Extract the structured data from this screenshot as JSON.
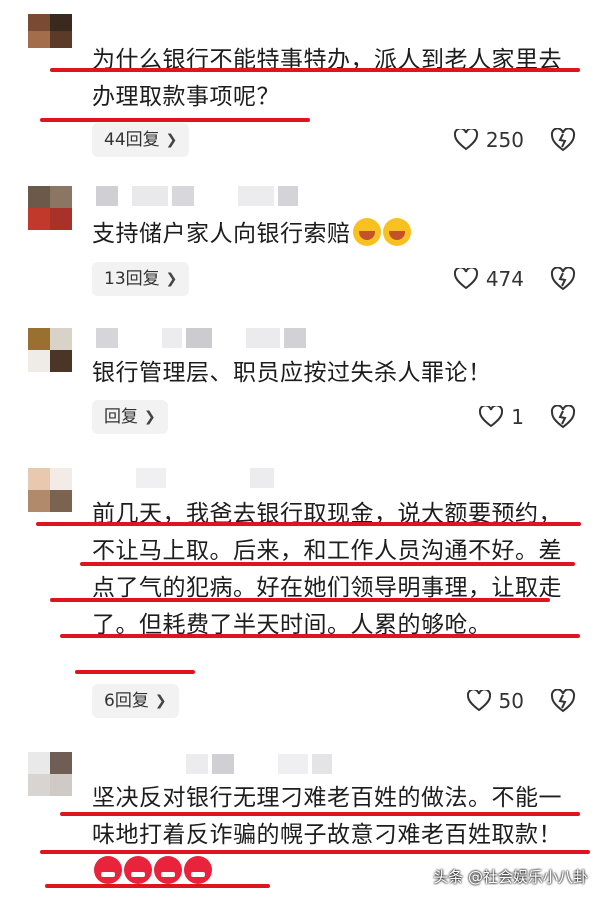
{
  "comments": [
    {
      "text": "为什么银行不能特事特办，派人到老人家里去办理取款事项呢？",
      "reply_label": "44回复",
      "likes": "250"
    },
    {
      "text": "支持储户家人向银行索赔",
      "reply_label": "13回复",
      "likes": "474"
    },
    {
      "text": "银行管理层、职员应按过失杀人罪论！",
      "reply_label": "回复",
      "likes": "1"
    },
    {
      "text": "前几天，我爸去银行取现金，说大额要预约，不让马上取。后来，和工作人员沟通不好。差点了气的犯病。好在她们领导明事理，让取走了。但耗费了半天时间。人累的够呛。",
      "reply_label": "6回复",
      "likes": "50"
    },
    {
      "text": "坚决反对银行无理刁难老百姓的做法。不能一味地打着反诈骗的幌子故意刁难老百姓取款！",
      "reply_label": "",
      "likes": ""
    }
  ],
  "watermark": "头条 @社会娱乐小八卦",
  "icons": {
    "like": "heart-outline-icon",
    "dislike": "broken-heart-icon",
    "chevron": "chevron-right-icon"
  },
  "colors": {
    "underline": "#e0141e",
    "pill_bg": "#f2f2f3"
  }
}
